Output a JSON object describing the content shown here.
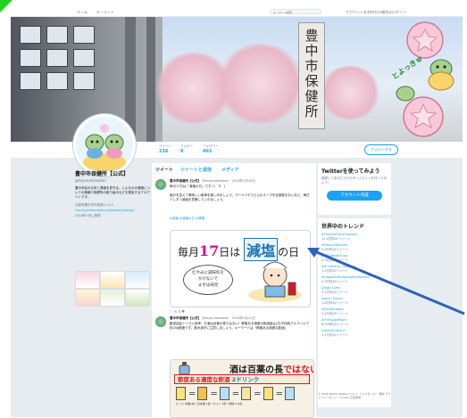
{
  "nav": {
    "home": "ホーム",
    "notifications": "モーメント",
    "search_placeholder": "キーワード検索",
    "right_text": "アカウントをお持ちの場合はログイン"
  },
  "banner": {
    "sign_text": "豊中市保健所",
    "deco_text": "とよっきゅ"
  },
  "profile": {
    "name": "豊中市保健所【公式】",
    "handle": "@toyonakahoken",
    "bio": "豊中市民の元気と健康を見守る、とよなかの健康についての情報や保健所の取り組みなどを発信するアカウントです。",
    "location": "大阪府豊中市中桜塚4-11-1",
    "link": "city.toyonaka.osaka.jp/kenko/hokenjo/",
    "joined": "2018年3月に登録"
  },
  "stats": [
    {
      "label": "ツイート",
      "value": "216"
    },
    {
      "label": "フォロー",
      "value": "8"
    },
    {
      "label": "フォロワー",
      "value": "461"
    }
  ],
  "follow_label": "フォローする",
  "tabs": [
    "ツイート",
    "ツイートと返信",
    "メディア"
  ],
  "tweet1": {
    "account": "豊中市保健所【公式】",
    "handle": "@toyonakahoken · 2018年3月16日",
    "line1": "毎月17日は「減塩の日」ですヾ(＾∇＾)",
    "body": "塩分を控えて美味しい食事を楽しみましょう。ラーメンやうどんのスープを全部飲まないなど、毎日少しずつ減塩を意識していきましょう。",
    "tags": "#減塩 #減塩の日 #健康",
    "card_prefix": "毎月",
    "card_num": "17",
    "card_mid": "日は",
    "card_box": "減塩",
    "card_suffix": "の日",
    "bubble": "むやみに調味料を\nかけないで\nまずは味見",
    "actions": "♡   ⟲ 4   ♥"
  },
  "tweet2": {
    "account": "豊中市保健所【公式】",
    "handle": "@toyonakahoken · 2018年3月14日",
    "body": "歓送迎会シーズン到来！お酒は百薬の長ではない！節度ある適度な飲酒量は1日平均純アルコールで約20g程度です。飲み過ぎに注意しましょう。キーワードは「節度ある適度な飲酒」",
    "card_title_a": "酒は百薬の長",
    "card_title_b": "ではない！",
    "card_band_a": "節度ある適度な飲酒",
    "card_band_b": "2ドリンク",
    "card_small": "ビール 中瓶1本 / 日本酒 1合 / ワイン 2杯 / 焼酎 0.6合"
  },
  "who_panel": {
    "title": "Twitterを使ってみよう",
    "text": "登録してあなただけのタイムラインを作ってみよう！",
    "button": "アカウント作成"
  },
  "trends": {
    "title": "世界中のトレンド",
    "items": [
      {
        "tag": "#FestivalDeLaCanzone",
        "count": "11.2万件のツイート"
      },
      {
        "tag": "#MoneyHeist4th",
        "count": "4.6万件のツイート"
      },
      {
        "tag": "#NBATwitterLive",
        "count": "2.3万件のツイート"
      },
      {
        "tag": "#El Heist vs Cristiano",
        "count": "1.2万件のツイート"
      },
      {
        "tag": "#HappyBirthdayNafeesRedsat",
        "count": "5.9万件のツイート"
      },
      {
        "tag": "Diego Alves",
        "count": "3.2万件のツイート"
      },
      {
        "tag": "Jasmin Conen",
        "count": "1.8万件のツイート"
      },
      {
        "tag": "#DAZNGalaxy",
        "count": "1.4万件のツイート"
      },
      {
        "tag": "#TheGoodPlace",
        "count": "8,976件のツイート"
      },
      {
        "tag": "Danielle Milani",
        "count": "1.1万件のツイート"
      }
    ]
  },
  "footer": "© 2018 Twitter  Twitterについて  ヘルプセンター  規約  プライバシーポリシー  Cookie  広告情報"
}
